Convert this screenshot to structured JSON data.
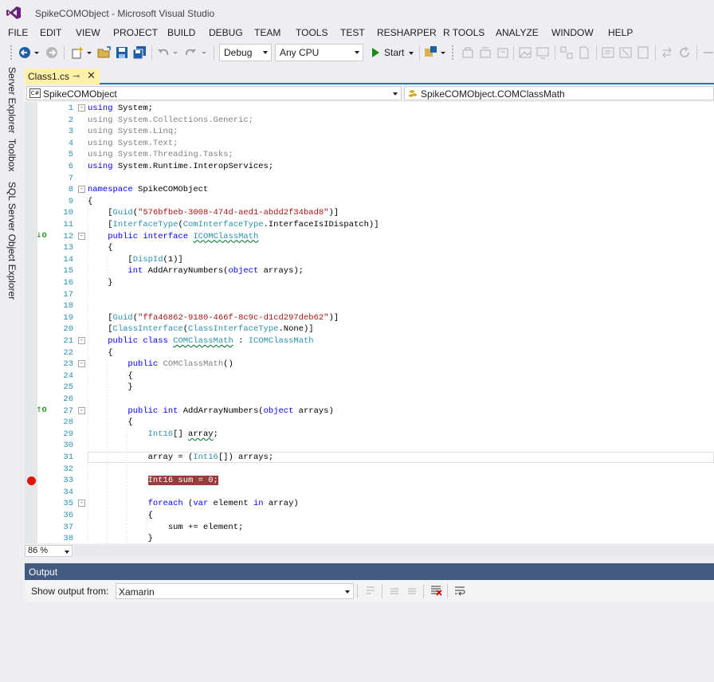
{
  "window": {
    "title": "SpikeCOMObject - Microsoft Visual Studio"
  },
  "menu": [
    "FILE",
    "EDIT",
    "VIEW",
    "PROJECT",
    "BUILD",
    "DEBUG",
    "TEAM",
    "TOOLS",
    "TEST",
    "RESHARPER",
    "R TOOLS",
    "ANALYZE",
    "WINDOW",
    "HELP"
  ],
  "toolbar": {
    "configuration": "Debug",
    "platform": "Any CPU",
    "start_label": "Start",
    "icons": [
      "back-icon",
      "forward-icon",
      "new-project-icon",
      "open-file-icon",
      "save-icon",
      "save-all-icon",
      "undo-icon",
      "redo-icon",
      "find-icon"
    ]
  },
  "sidebar": {
    "tabs": [
      "Server Explorer",
      "Toolbox",
      "SQL Server Object Explorer"
    ]
  },
  "document": {
    "tab_label": "Class1.cs",
    "pin_glyph": "⊸",
    "close_glyph": "✕",
    "nav_left": "SpikeCOMObject",
    "nav_left_icon": "C#",
    "nav_right": "SpikeCOMObject.COMClassMath"
  },
  "code_lines": [
    {
      "n": "1",
      "fold": "-",
      "segs": [
        [
          "kw",
          "using"
        ],
        [
          "t",
          " System;"
        ]
      ]
    },
    {
      "n": "2",
      "segs": [
        [
          "dim",
          "using System.Collections.Generic;"
        ]
      ]
    },
    {
      "n": "3",
      "segs": [
        [
          "dim",
          "using System.Linq;"
        ]
      ]
    },
    {
      "n": "4",
      "segs": [
        [
          "dim",
          "using System.Text;"
        ]
      ]
    },
    {
      "n": "5",
      "segs": [
        [
          "dim",
          "using System.Threading.Tasks;"
        ]
      ]
    },
    {
      "n": "6",
      "segs": [
        [
          "kw",
          "using"
        ],
        [
          "t",
          " System.Runtime.InteropServices;"
        ]
      ]
    },
    {
      "n": "7",
      "segs": []
    },
    {
      "n": "8",
      "fold": "-",
      "segs": [
        [
          "kw",
          "namespace"
        ],
        [
          "t",
          " SpikeCOMObject"
        ]
      ]
    },
    {
      "n": "9",
      "segs": [
        [
          "t",
          "{"
        ]
      ]
    },
    {
      "n": "10",
      "segs": [
        [
          "t",
          "    ["
        ],
        [
          "ty",
          "Guid"
        ],
        [
          "t",
          "("
        ],
        [
          "str",
          "\"576bfbeb-3008-474d-aed1-abdd2f34bad8\""
        ],
        [
          "t",
          ")]"
        ]
      ]
    },
    {
      "n": "11",
      "segs": [
        [
          "t",
          "    ["
        ],
        [
          "ty",
          "InterfaceType"
        ],
        [
          "t",
          "("
        ],
        [
          "ty",
          "ComInterfaceType"
        ],
        [
          "t",
          ".InterfaceIsIDispatch)]"
        ]
      ]
    },
    {
      "n": "12",
      "fold": "-",
      "glyph": "↓0",
      "segs": [
        [
          "t",
          "    "
        ],
        [
          "kw",
          "public interface"
        ],
        [
          "t",
          " "
        ],
        [
          "tysq",
          "ICOMClassMath"
        ]
      ]
    },
    {
      "n": "13",
      "segs": [
        [
          "t",
          "    {"
        ]
      ]
    },
    {
      "n": "14",
      "segs": [
        [
          "t",
          "        ["
        ],
        [
          "ty",
          "DispId"
        ],
        [
          "t",
          "(1)]"
        ]
      ]
    },
    {
      "n": "15",
      "segs": [
        [
          "t",
          "        "
        ],
        [
          "kw",
          "int"
        ],
        [
          "t",
          " AddArrayNumbers("
        ],
        [
          "kw",
          "object"
        ],
        [
          "t",
          " arrays);"
        ]
      ]
    },
    {
      "n": "16",
      "segs": [
        [
          "t",
          "    }"
        ]
      ]
    },
    {
      "n": "17",
      "segs": []
    },
    {
      "n": "18",
      "segs": []
    },
    {
      "n": "19",
      "segs": [
        [
          "t",
          "    ["
        ],
        [
          "ty",
          "Guid"
        ],
        [
          "t",
          "("
        ],
        [
          "str",
          "\"ffa46862-9180-466f-8c9c-d1cd297deb62\""
        ],
        [
          "t",
          ")]"
        ]
      ]
    },
    {
      "n": "20",
      "segs": [
        [
          "t",
          "    ["
        ],
        [
          "ty",
          "ClassInterface"
        ],
        [
          "t",
          "("
        ],
        [
          "ty",
          "ClassInterfaceType"
        ],
        [
          "t",
          ".None)]"
        ]
      ]
    },
    {
      "n": "21",
      "fold": "-",
      "segs": [
        [
          "t",
          "    "
        ],
        [
          "kw",
          "public class"
        ],
        [
          "t",
          " "
        ],
        [
          "tysq",
          "COMClassMath"
        ],
        [
          "t",
          " : "
        ],
        [
          "ty",
          "ICOMClassMath"
        ]
      ]
    },
    {
      "n": "22",
      "segs": [
        [
          "t",
          "    {"
        ]
      ]
    },
    {
      "n": "23",
      "fold": "-",
      "segs": [
        [
          "t",
          "        "
        ],
        [
          "kw",
          "public"
        ],
        [
          "t",
          " "
        ],
        [
          "dim",
          "COMClassMath"
        ],
        [
          "t",
          "()"
        ]
      ]
    },
    {
      "n": "24",
      "segs": [
        [
          "t",
          "        {"
        ]
      ]
    },
    {
      "n": "25",
      "segs": [
        [
          "t",
          "        }"
        ]
      ]
    },
    {
      "n": "26",
      "segs": []
    },
    {
      "n": "27",
      "fold": "-",
      "glyph": "↑0",
      "segs": [
        [
          "t",
          "        "
        ],
        [
          "kw",
          "public int"
        ],
        [
          "t",
          " AddArrayNumbers("
        ],
        [
          "kw",
          "object"
        ],
        [
          "t",
          " arrays)"
        ]
      ]
    },
    {
      "n": "28",
      "segs": [
        [
          "t",
          "        {"
        ]
      ]
    },
    {
      "n": "29",
      "segs": [
        [
          "t",
          "            "
        ],
        [
          "ty",
          "Int16"
        ],
        [
          "t",
          "[] "
        ],
        [
          "sq",
          "array"
        ],
        [
          "t",
          ";"
        ]
      ]
    },
    {
      "n": "30",
      "segs": []
    },
    {
      "n": "31",
      "current": true,
      "segs": [
        [
          "t",
          "            array = ("
        ],
        [
          "ty",
          "Int16"
        ],
        [
          "t",
          "[]) arrays;"
        ]
      ]
    },
    {
      "n": "32",
      "segs": []
    },
    {
      "n": "33",
      "breakpoint": true,
      "segs": [
        [
          "t",
          "            "
        ],
        [
          "bp",
          "Int16 sum = 0;"
        ]
      ]
    },
    {
      "n": "34",
      "segs": []
    },
    {
      "n": "35",
      "fold": "-",
      "segs": [
        [
          "t",
          "            "
        ],
        [
          "kw",
          "foreach"
        ],
        [
          "t",
          " ("
        ],
        [
          "kw",
          "var"
        ],
        [
          "t",
          " element "
        ],
        [
          "kw",
          "in"
        ],
        [
          "t",
          " array)"
        ]
      ]
    },
    {
      "n": "36",
      "segs": [
        [
          "t",
          "            {"
        ]
      ]
    },
    {
      "n": "37",
      "segs": [
        [
          "t",
          "                sum += element;"
        ]
      ]
    },
    {
      "n": "38",
      "segs": [
        [
          "t",
          "            }"
        ]
      ]
    }
  ],
  "zoom": "86 %",
  "output": {
    "title": "Output",
    "show_from_label": "Show output from:",
    "source": "Xamarin"
  }
}
